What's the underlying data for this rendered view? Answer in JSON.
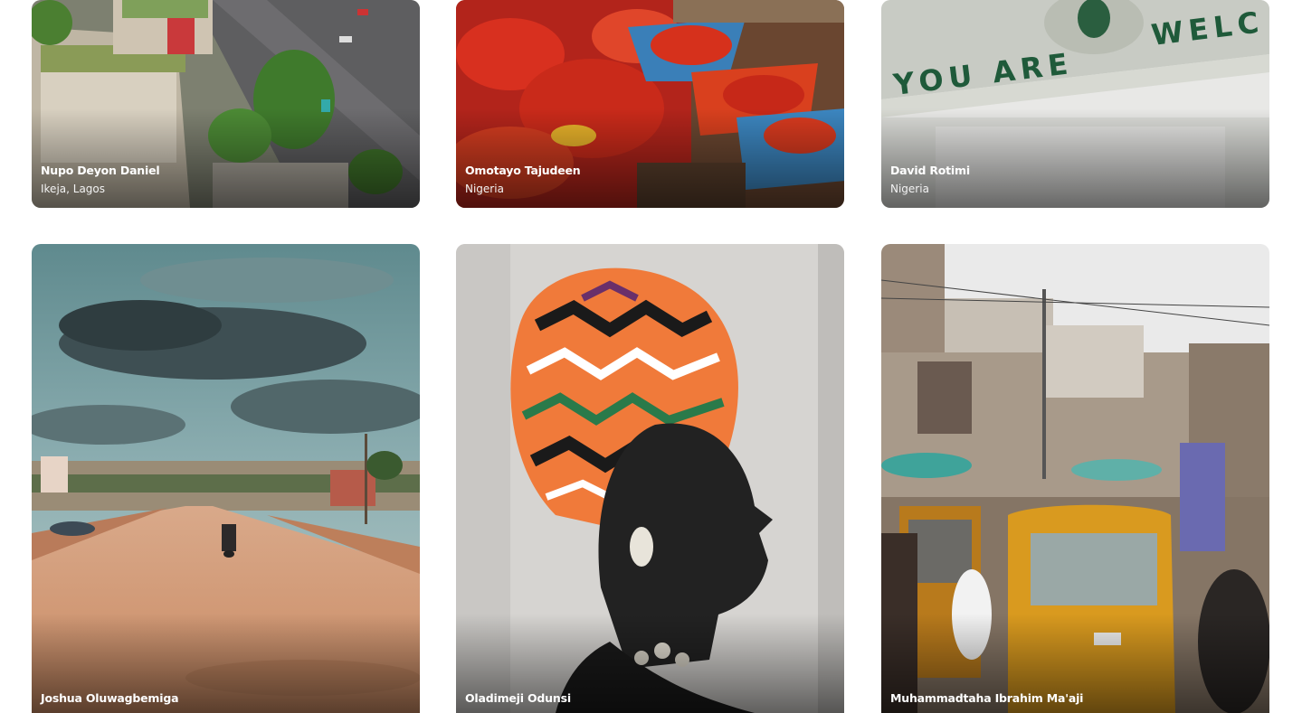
{
  "photos": [
    {
      "photographer": "Nupo Deyon Daniel",
      "location": "Ikeja, Lagos",
      "scene": "aerial-city-road-photo"
    },
    {
      "photographer": "Omotayo Tajudeen",
      "location": "Nigeria",
      "scene": "market-peppers-photo"
    },
    {
      "photographer": "David Rotimi",
      "location": "Nigeria",
      "scene": "welcome-gate-photo"
    },
    {
      "photographer": "Joshua Oluwagbemiga",
      "location": "",
      "scene": "dirt-road-storm-photo"
    },
    {
      "photographer": "Oladimeji Odunsi",
      "location": "",
      "scene": "headwrap-portrait-photo"
    },
    {
      "photographer": "Muhammadtaha Ibrahim Ma'aji",
      "location": "",
      "scene": "street-keke-photo"
    }
  ]
}
